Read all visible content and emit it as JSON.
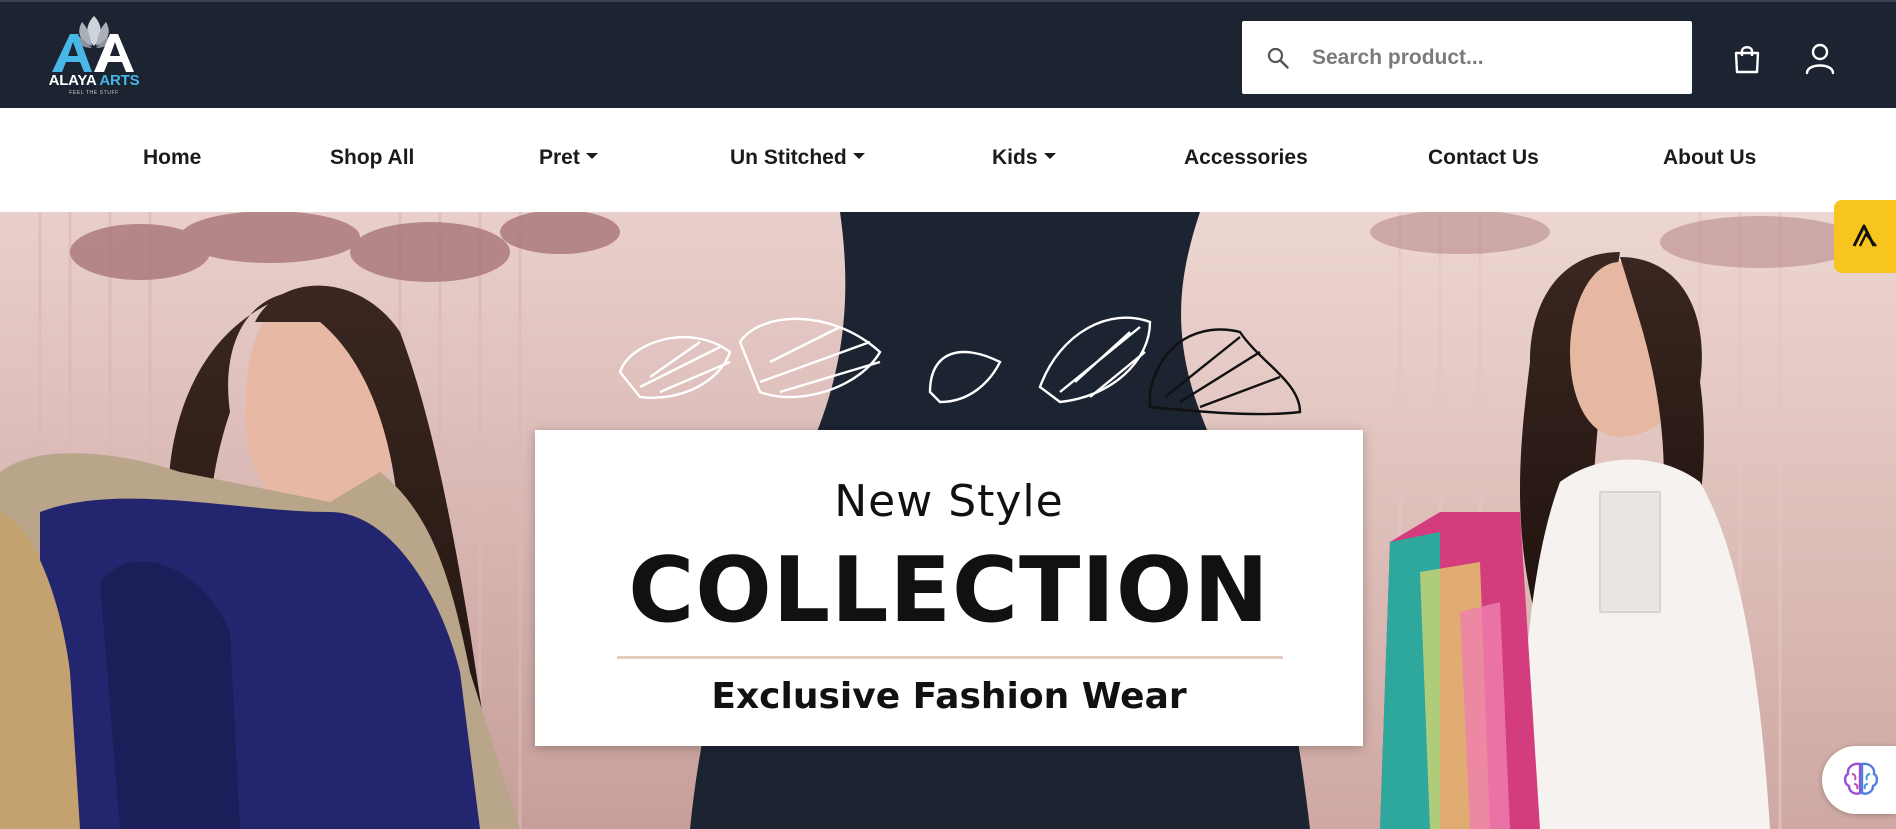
{
  "brand": {
    "name_primary": "ALAYA",
    "name_accent": "ARTS",
    "tagline": "FEEL THE STUFF"
  },
  "header": {
    "search_placeholder": "Search product...",
    "search_value": "",
    "cart_icon": "shopping-bag-icon",
    "user_icon": "user-icon"
  },
  "nav": {
    "items": [
      {
        "label": "Home",
        "has_dropdown": false
      },
      {
        "label": "Shop All",
        "has_dropdown": false
      },
      {
        "label": "Pret",
        "has_dropdown": true
      },
      {
        "label": "Un Stitched",
        "has_dropdown": true
      },
      {
        "label": "Kids",
        "has_dropdown": true
      },
      {
        "label": "Accessories",
        "has_dropdown": false
      },
      {
        "label": "Contact Us",
        "has_dropdown": false
      },
      {
        "label": "About Us",
        "has_dropdown": false
      }
    ]
  },
  "hero": {
    "subtitle": "New Style",
    "title": "COLLECTION",
    "tagline": "Exclusive Fashion Wear"
  },
  "widgets": {
    "side_tab_icon": "brand-a-icon",
    "ai_icon": "brain-icon"
  },
  "colors": {
    "header_bg": "#1c2331",
    "accent_blue": "#49b6e8",
    "side_tab_yellow": "#f7c51e",
    "hero_pink": "#d9b3b0"
  }
}
